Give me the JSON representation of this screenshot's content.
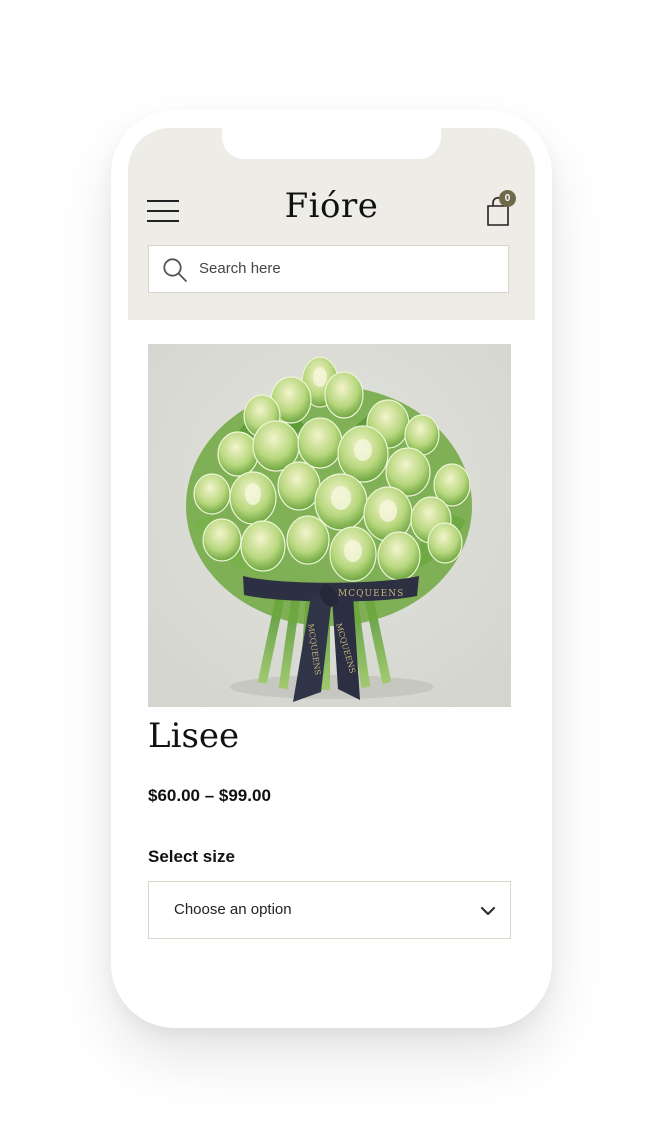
{
  "header": {
    "logo_text": "Fióre",
    "cart_count": "0"
  },
  "search": {
    "placeholder": "Search here"
  },
  "product": {
    "title": "Lisee",
    "price_range": "$60.00 – $99.00",
    "image_ribbon_text": "MCQUEENS"
  },
  "size": {
    "label": "Select size",
    "selected_value": "Choose an option"
  },
  "icons": {
    "menu": "hamburger-menu-icon",
    "cart": "shopping-bag-icon",
    "search": "search-icon",
    "select": "chevron-down-icon"
  },
  "colors": {
    "header_bg": "#eeece6",
    "badge_bg": "#6d6a4b",
    "border": "#d8d4ca",
    "product_bg": "#dcddd7"
  }
}
